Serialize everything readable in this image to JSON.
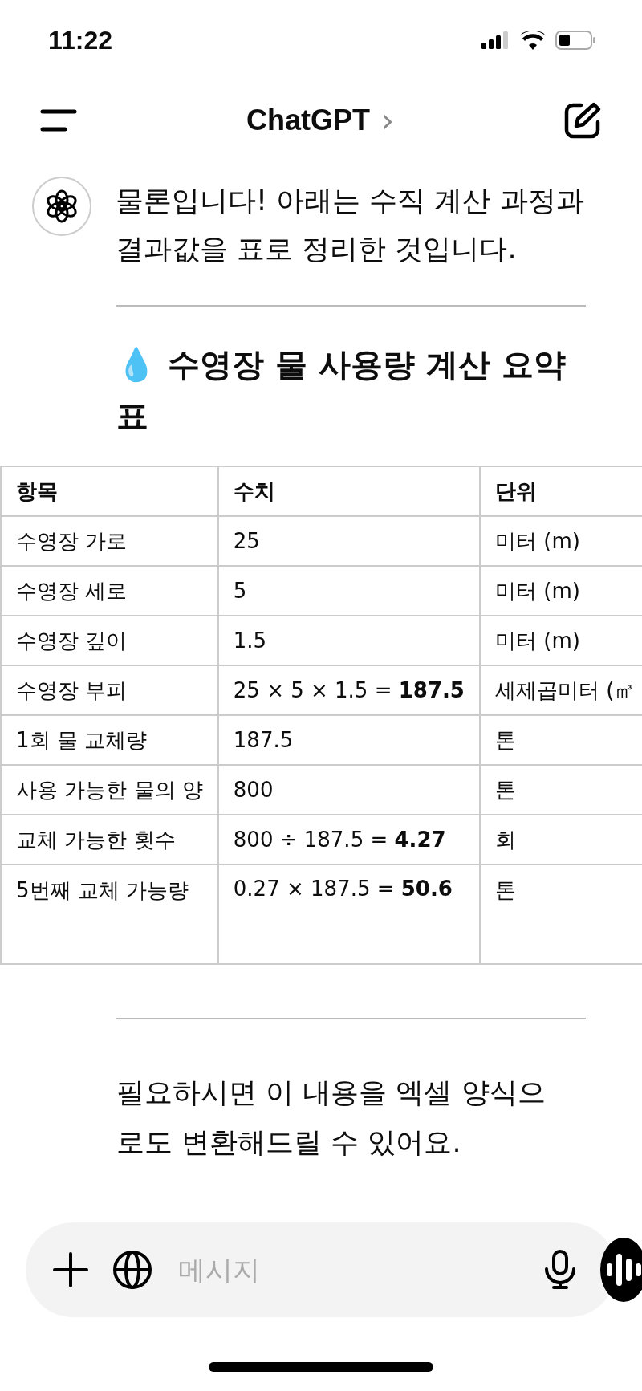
{
  "status_bar": {
    "time": "11:22"
  },
  "header": {
    "title": "ChatGPT",
    "chevron": "›"
  },
  "message": {
    "text": "물론입니다! 아래는 수직 계산 과정과 결과값을 표로 정리한 것입니다."
  },
  "heading": {
    "emoji": "💧",
    "text": "수영장 물 사용량 계산 요약표"
  },
  "table": {
    "columns": [
      "항목",
      "수치",
      "단위"
    ],
    "rows": [
      [
        "수영장 가로",
        "25",
        "미터 (m)"
      ],
      [
        "수영장 세로",
        "5",
        "미터 (m)"
      ],
      [
        "수영장 깊이",
        "1.5",
        "미터 (m)"
      ],
      [
        "수영장 부피",
        "25 × 5 × 1.5 = **187.5**",
        "세제곱미터 (㎥"
      ],
      [
        "1회 물 교체량",
        "187.5",
        "톤"
      ],
      [
        "사용 가능한 물의 양",
        "800",
        "톤"
      ],
      [
        "교체 가능한 횟수",
        "800 ÷ 187.5 = **4.27**",
        "회"
      ],
      [
        "5번째 교체 가능량",
        "0.27 × 187.5 = **50.6**",
        "톤"
      ]
    ]
  },
  "closing": {
    "text": "필요하시면 이 내용을 엑셀 양식으로도 변환해드릴 수 있어요."
  },
  "composer": {
    "placeholder": "메시지"
  }
}
